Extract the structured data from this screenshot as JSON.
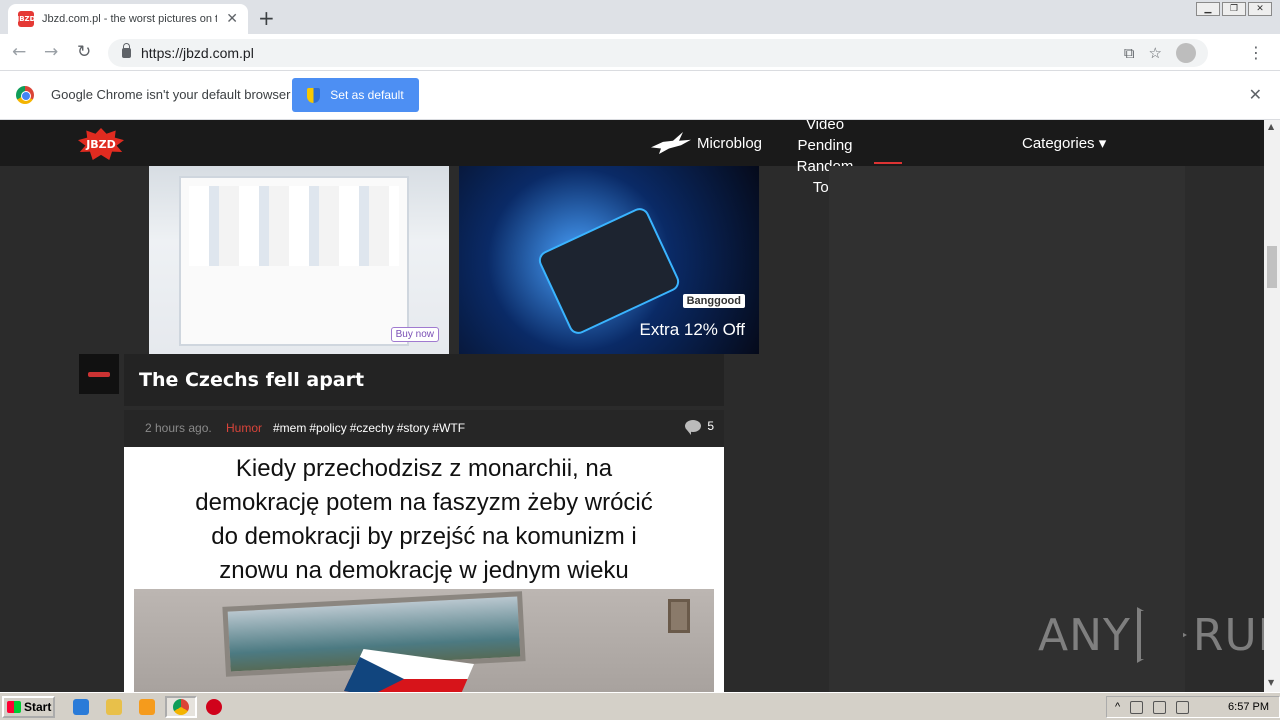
{
  "browser": {
    "tab_title": "Jbzd.com.pl - the worst pictures on t",
    "tab_favicon": "JBZD",
    "url": "https://jbzd.com.pl",
    "window_controls": [
      "minimize-icon",
      "restore-icon",
      "close-icon"
    ]
  },
  "infobar": {
    "message": "Google Chrome isn't your default browser",
    "button_label": "Set as default"
  },
  "site": {
    "logo": "JBZD",
    "nav": {
      "microblog": "Microblog",
      "stack": [
        "Video",
        "Pending",
        "Random",
        "Top"
      ],
      "categories": "Categories ▾"
    }
  },
  "ads": {
    "left_cta": "Buy now",
    "right_brand": "Banggood",
    "right_offer": "Extra 12% Off"
  },
  "post": {
    "title": "The Czechs fell apart",
    "time": "2 hours ago.",
    "category": "Humor",
    "tags": [
      "#mem",
      "#policy",
      "#czechy",
      "#story",
      "#WTF"
    ],
    "comments": "5",
    "meme_caption": [
      "Kiedy przechodzisz z monarchii, na",
      "demokrację potem na faszyzm żeby wrócić",
      "do demokracji by przejść na komunizm i",
      "znowu na demokrację w jednym wieku"
    ]
  },
  "watermark": {
    "left": "ANY",
    "right": "RUN"
  },
  "taskbar": {
    "start": "Start",
    "clock": "6:57 PM"
  },
  "colors": {
    "accent_red": "#d9443a",
    "chrome_blue": "#4d8ff3",
    "page_bg": "#2b2b2b"
  }
}
